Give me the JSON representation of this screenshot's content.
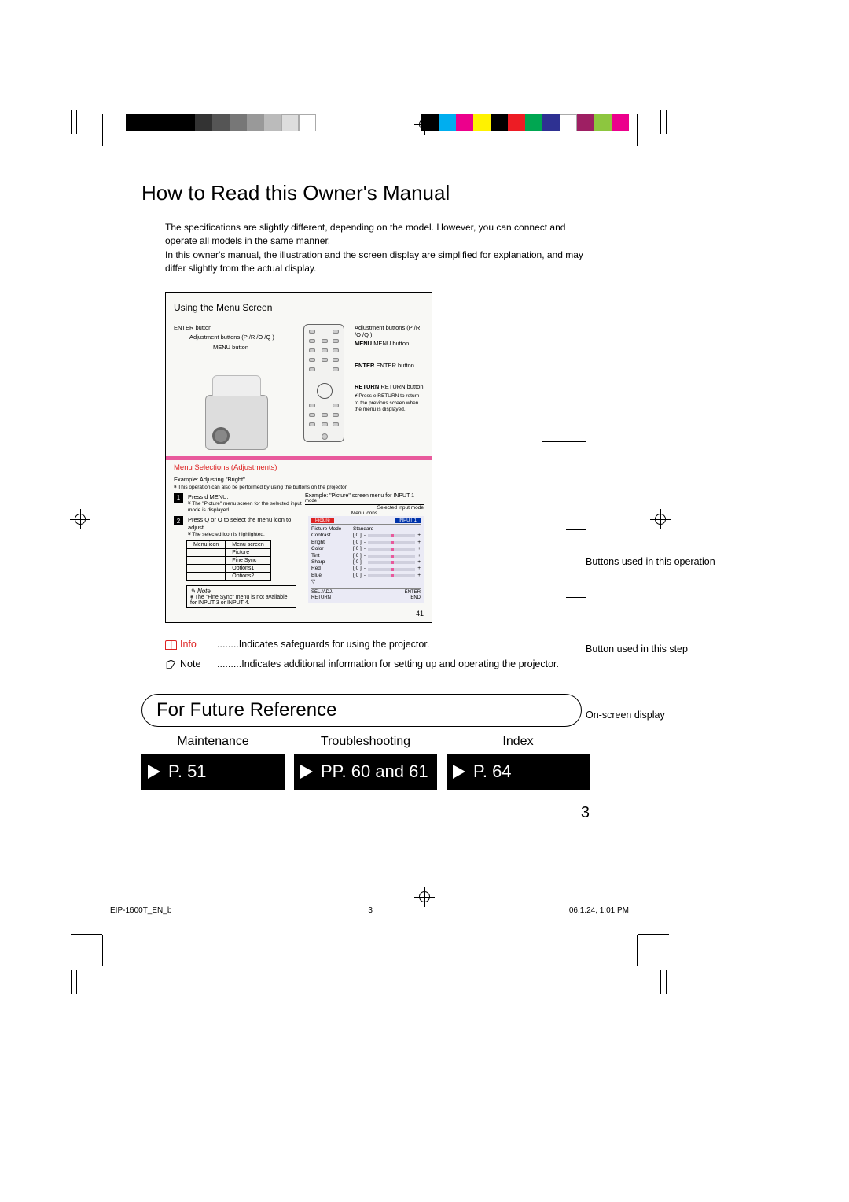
{
  "title": "How to Read this Owner's Manual",
  "intro": {
    "p1": "The specifications are slightly different, depending on the model. However, you can connect and operate all models in the same manner.",
    "p2": "In this owner's manual, the illustration and the screen display are simplified for explanation, and may differ slightly from the actual display."
  },
  "diagram": {
    "section_title": "Using the Menu Screen",
    "projector_labels": {
      "enter": "ENTER button",
      "adjust": "Adjustment buttons (P /R /O /Q )",
      "menu": "MENU button"
    },
    "remote_labels": {
      "adjust": "Adjustment buttons (P /R /O /Q )",
      "menu_label": "MENU",
      "menu_btn": "MENU button",
      "enter_label": "ENTER",
      "enter_btn": "ENTER button",
      "return_label": "RETURN",
      "return_btn": "RETURN button",
      "note": "¥ Press e RETURN to return to the previous screen when the menu is displayed."
    },
    "red_heading": "Menu Selections (Adjustments)",
    "example_line": "Example: Adjusting \"Bright\"",
    "sub_line": "¥ This operation can also be performed by using the buttons on the projector.",
    "step1": {
      "num": "1",
      "text": "Press d MENU.",
      "small": "¥ The \"Picture\" menu screen for the selected input mode is displayed."
    },
    "step2": {
      "num": "2",
      "text": "Press Q or O to select the menu icon to adjust.",
      "small": "¥ The selected icon is highlighted."
    },
    "table": {
      "h1": "Menu icon",
      "h2": "Menu screen",
      "r1": "Picture",
      "r2": "Fine Sync",
      "r3": "Options1",
      "r4": "Options2"
    },
    "osd": {
      "hdr_example": "Example: \"Picture\" screen menu for INPUT 1",
      "hdr_mode": "mode",
      "hdr_selected": "Selected input mode",
      "hdr_icons": "Menu icons",
      "tab": "Picture",
      "input": "INPUT 1",
      "rows": [
        {
          "l": "Picture Mode",
          "v": "Standard"
        },
        {
          "l": "Contrast",
          "v": "[   0 ]"
        },
        {
          "l": "Bright",
          "v": "[   0 ]"
        },
        {
          "l": "Color",
          "v": "[   0 ]"
        },
        {
          "l": "Tint",
          "v": "[   0 ]"
        },
        {
          "l": "Sharp",
          "v": "[   0 ]"
        },
        {
          "l": "Red",
          "v": "[   0 ]"
        },
        {
          "l": "Blue",
          "v": "[   0 ]"
        }
      ],
      "ftr": {
        "a": "SEL./ADJ.",
        "b": "ENTER",
        "c": "RETURN",
        "d": "END"
      }
    },
    "notebox": {
      "title": "Note",
      "text": "¥ The \"Fine Sync\" menu is not available for INPUT 3 or INPUT 4."
    },
    "page": "41"
  },
  "callouts": {
    "c1": "Buttons used in this operation",
    "c2": "Button used in this step",
    "c3": "On-screen display"
  },
  "legend": {
    "info_label": "Info",
    "info_text": "........Indicates safeguards for using the projector.",
    "note_label": "Note",
    "note_text": ".........Indicates additional information for setting up and operating the projector."
  },
  "future": {
    "heading": "For Future Reference",
    "cols": [
      {
        "title": "Maintenance",
        "page": "P. 51"
      },
      {
        "title": "Troubleshooting",
        "page": "PP. 60 and 61"
      },
      {
        "title": "Index",
        "page": "P. 64"
      }
    ]
  },
  "page_number": "3",
  "footer": {
    "file": "EIP-1600T_EN_b",
    "mid": "3",
    "ts": "06.1.24, 1:01 PM"
  },
  "reg_colors_bw": [
    "#000",
    "#000",
    "#000",
    "#000",
    "#333",
    "#555",
    "#777",
    "#999",
    "#bbb",
    "#ddd",
    "#fff"
  ],
  "reg_colors_hue": [
    "#000",
    "#00aeef",
    "#ec008c",
    "#fff200",
    "#000",
    "#ed1c24",
    "#00a651",
    "#2e3192",
    "#fff",
    "#9e1f63",
    "#8dc63f",
    "#00aeef",
    "#ec008c",
    "#fff"
  ]
}
